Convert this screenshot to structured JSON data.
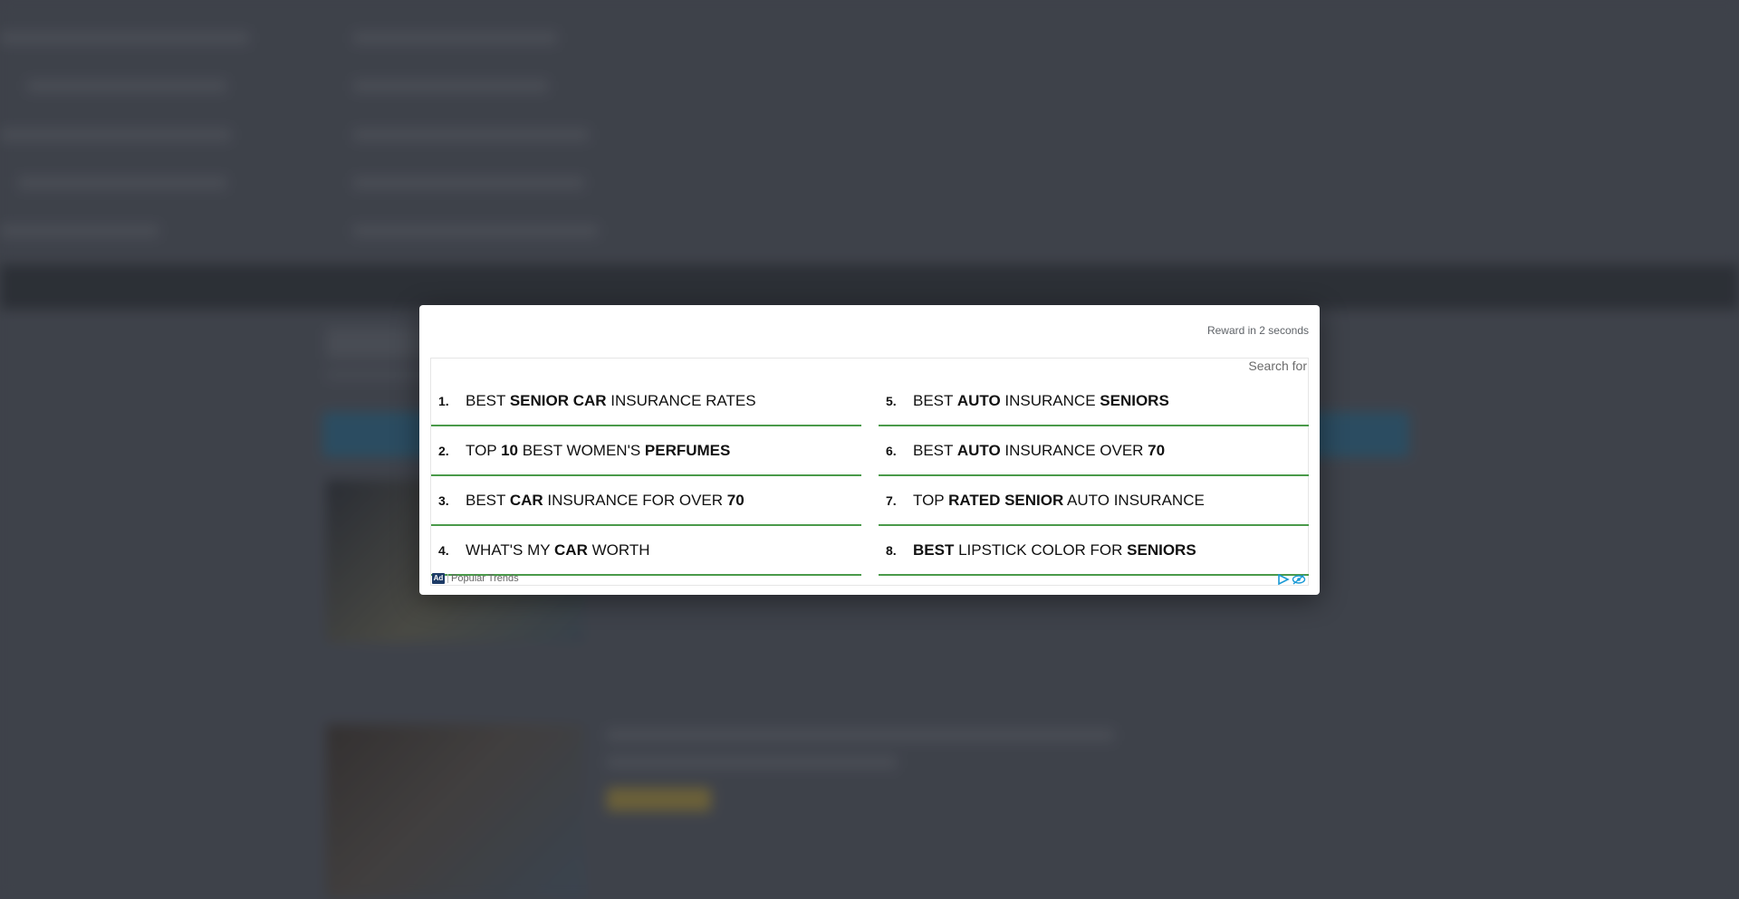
{
  "modal": {
    "reward_text": "Reward in 2 seconds",
    "search_for": "Search for",
    "footer_label": "Popular Trends",
    "ad_badge": "Ad",
    "glyph": "",
    "arrow_glyph": "",
    "accent_color": "#4a9a4a",
    "items": [
      {
        "num": "1.",
        "parts": [
          {
            "t": "BEST ",
            "b": false
          },
          {
            "t": "SENIOR CAR",
            "b": true
          },
          {
            "t": " INSURANCE RATES",
            "b": false
          }
        ]
      },
      {
        "num": "2.",
        "parts": [
          {
            "t": "TOP ",
            "b": false
          },
          {
            "t": "10",
            "b": true
          },
          {
            "t": " BEST WOMEN'S ",
            "b": false
          },
          {
            "t": "PERFUMES",
            "b": true
          }
        ]
      },
      {
        "num": "3.",
        "parts": [
          {
            "t": "BEST ",
            "b": false
          },
          {
            "t": "CAR",
            "b": true
          },
          {
            "t": " INSURANCE FOR OVER ",
            "b": false
          },
          {
            "t": "70",
            "b": true
          }
        ]
      },
      {
        "num": "4.",
        "parts": [
          {
            "t": "WHAT'S MY ",
            "b": false
          },
          {
            "t": "CAR",
            "b": true
          },
          {
            "t": " WORTH",
            "b": false
          }
        ]
      },
      {
        "num": "5.",
        "parts": [
          {
            "t": "BEST ",
            "b": false
          },
          {
            "t": "AUTO",
            "b": true
          },
          {
            "t": " INSURANCE ",
            "b": false
          },
          {
            "t": "SENIORS",
            "b": true
          }
        ]
      },
      {
        "num": "6.",
        "parts": [
          {
            "t": "BEST ",
            "b": false
          },
          {
            "t": "AUTO",
            "b": true
          },
          {
            "t": " INSURANCE OVER ",
            "b": false
          },
          {
            "t": "70",
            "b": true
          }
        ]
      },
      {
        "num": "7.",
        "parts": [
          {
            "t": "TOP ",
            "b": false
          },
          {
            "t": "RATED SENIOR",
            "b": true
          },
          {
            "t": " AUTO INSURANCE",
            "b": false
          }
        ]
      },
      {
        "num": "8.",
        "parts": [
          {
            "t": "BEST",
            "b": true
          },
          {
            "t": " LIPSTICK COLOR FOR ",
            "b": false
          },
          {
            "t": "SENIORS",
            "b": true
          }
        ]
      }
    ]
  }
}
